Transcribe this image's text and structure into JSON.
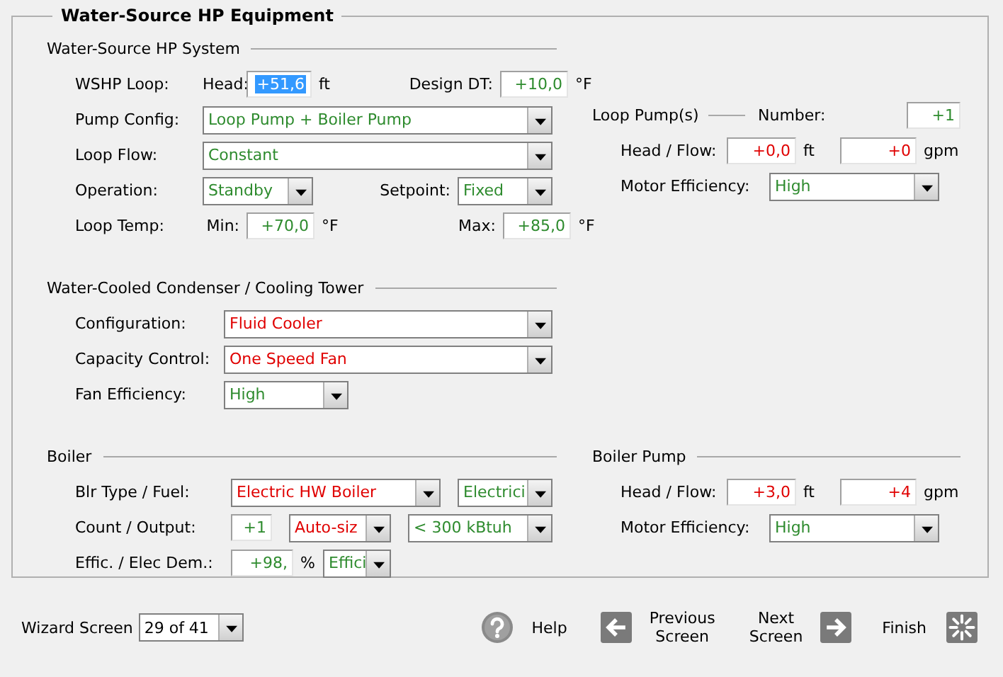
{
  "title": "Water-Source HP Equipment",
  "wshp": {
    "title": "Water-Source HP System",
    "loop_label": "WSHP Loop:",
    "head_label": "Head:",
    "head": {
      "value": "+51,6",
      "color": "#ffffff",
      "selected": true
    },
    "head_unit": "ft",
    "dt_label": "Design DT:",
    "dt": {
      "value": "+10,0",
      "color": "#2e8b2e"
    },
    "dt_unit": "°F",
    "pump_config_label": "Pump Config:",
    "pump_config": {
      "value": "Loop Pump + Boiler Pump",
      "color": "#2e8b2e"
    },
    "loop_flow_label": "Loop Flow:",
    "loop_flow": {
      "value": "Constant",
      "color": "#2e8b2e"
    },
    "operation_label": "Operation:",
    "operation": {
      "value": "Standby",
      "color": "#2e8b2e"
    },
    "setpoint_label": "Setpoint:",
    "setpoint": {
      "value": "Fixed",
      "color": "#2e8b2e"
    },
    "temp_label": "Loop Temp:",
    "min_label": "Min:",
    "min": {
      "value": "+70,0",
      "color": "#2e8b2e"
    },
    "min_unit": "°F",
    "max_label": "Max:",
    "max": {
      "value": "+85,0",
      "color": "#2e8b2e"
    },
    "max_unit": "°F"
  },
  "loop_pumps": {
    "title": "Loop Pump(s)",
    "number_label": "Number:",
    "number": {
      "value": "+1",
      "color": "#2e8b2e"
    },
    "head_flow_label": "Head / Flow:",
    "head": {
      "value": "+0,0",
      "color": "#e00000"
    },
    "head_unit": "ft",
    "flow": {
      "value": "+0",
      "color": "#e00000"
    },
    "flow_unit": "gpm",
    "motor_label": "Motor Efficiency:",
    "motor": {
      "value": "High",
      "color": "#2e8b2e"
    }
  },
  "condenser": {
    "title": "Water-Cooled Condenser / Cooling Tower",
    "config_label": "Configuration:",
    "config": {
      "value": "Fluid Cooler",
      "color": "#e00000"
    },
    "capacity_label": "Capacity Control:",
    "capacity": {
      "value": "One Speed Fan",
      "color": "#e00000"
    },
    "fan_label": "Fan Efficiency:",
    "fan": {
      "value": "High",
      "color": "#2e8b2e"
    }
  },
  "boiler": {
    "title": "Boiler",
    "type_label": "Blr Type / Fuel:",
    "type": {
      "value": "Electric HW Boiler",
      "color": "#e00000"
    },
    "fuel": {
      "value": "Electrici",
      "color": "#2e8b2e"
    },
    "count_label": "Count / Output:",
    "count": {
      "value": "+1",
      "color": "#2e8b2e"
    },
    "sizing": {
      "value": "Auto-siz",
      "color": "#e00000"
    },
    "output": {
      "value": "< 300 kBtuh",
      "color": "#2e8b2e"
    },
    "effic_label": "Effic. / Elec Dem.:",
    "effic": {
      "value": "+98,",
      "color": "#2e8b2e"
    },
    "effic_unit": "%",
    "effic_mode": {
      "value": "Effici",
      "color": "#2e8b2e"
    }
  },
  "boiler_pump": {
    "title": "Boiler Pump",
    "head_flow_label": "Head / Flow:",
    "head": {
      "value": "+3,0",
      "color": "#e00000"
    },
    "head_unit": "ft",
    "flow": {
      "value": "+4",
      "color": "#e00000"
    },
    "flow_unit": "gpm",
    "motor_label": "Motor Efficiency:",
    "motor": {
      "value": "High",
      "color": "#2e8b2e"
    }
  },
  "footer": {
    "wizard_label": "Wizard Screen",
    "wizard_screen": "29 of 41",
    "help": "Help",
    "previous": [
      "Previous",
      "Screen"
    ],
    "next": [
      "Next",
      "Screen"
    ],
    "finish": "Finish"
  }
}
